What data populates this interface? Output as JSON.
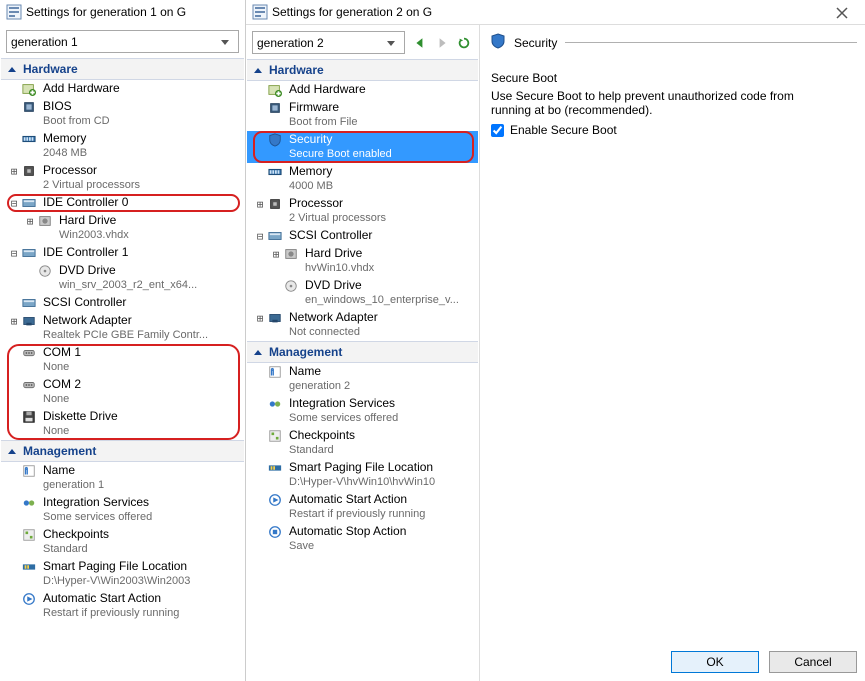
{
  "left": {
    "title": "Settings for generation 1 on G",
    "selector": "generation 1",
    "hardware_header": "Hardware",
    "management_header": "Management",
    "hardware": [
      {
        "label": "Add Hardware",
        "sub": "",
        "icon": "add-hardware",
        "exp": "",
        "indent": 0
      },
      {
        "label": "BIOS",
        "sub": "Boot from CD",
        "icon": "bios",
        "exp": "",
        "indent": 0
      },
      {
        "label": "Memory",
        "sub": "2048 MB",
        "icon": "memory",
        "exp": "",
        "indent": 0
      },
      {
        "label": "Processor",
        "sub": "2 Virtual processors",
        "icon": "cpu",
        "exp": "plus",
        "indent": 0
      },
      {
        "label": "IDE Controller 0",
        "sub": "",
        "icon": "ide",
        "exp": "minus",
        "indent": 0,
        "hl": "ide0"
      },
      {
        "label": "Hard Drive",
        "sub": "Win2003.vhdx",
        "icon": "hdd",
        "exp": "plus",
        "indent": 1
      },
      {
        "label": "IDE Controller 1",
        "sub": "",
        "icon": "ide",
        "exp": "minus",
        "indent": 0
      },
      {
        "label": "DVD Drive",
        "sub": "win_srv_2003_r2_ent_x64...",
        "icon": "dvd",
        "exp": "",
        "indent": 1
      },
      {
        "label": "SCSI Controller",
        "sub": "",
        "icon": "scsi",
        "exp": "",
        "indent": 0
      },
      {
        "label": "Network Adapter",
        "sub": "Realtek PCIe GBE Family Contr...",
        "icon": "nic",
        "exp": "plus",
        "indent": 0
      },
      {
        "label": "COM 1",
        "sub": "None",
        "icon": "com",
        "exp": "",
        "indent": 0,
        "grp": "extra"
      },
      {
        "label": "COM 2",
        "sub": "None",
        "icon": "com",
        "exp": "",
        "indent": 0,
        "grp": "extra"
      },
      {
        "label": "Diskette Drive",
        "sub": "None",
        "icon": "floppy",
        "exp": "",
        "indent": 0,
        "grp": "extra"
      }
    ],
    "management": [
      {
        "label": "Name",
        "sub": "generation 1",
        "icon": "name"
      },
      {
        "label": "Integration Services",
        "sub": "Some services offered",
        "icon": "integration"
      },
      {
        "label": "Checkpoints",
        "sub": "Standard",
        "icon": "checkpoint"
      },
      {
        "label": "Smart Paging File Location",
        "sub": "D:\\Hyper-V\\Win2003\\Win2003",
        "icon": "paging"
      },
      {
        "label": "Automatic Start Action",
        "sub": "Restart if previously running",
        "icon": "start"
      }
    ]
  },
  "right": {
    "title": "Settings for generation 2 on G",
    "selector": "generation 2",
    "hardware_header": "Hardware",
    "management_header": "Management",
    "hardware": [
      {
        "label": "Add Hardware",
        "sub": "",
        "icon": "add-hardware",
        "exp": "",
        "indent": 0
      },
      {
        "label": "Firmware",
        "sub": "Boot from File",
        "icon": "bios",
        "exp": "",
        "indent": 0
      },
      {
        "label": "Security",
        "sub": "Secure Boot enabled",
        "icon": "shield",
        "exp": "",
        "indent": 0,
        "selected": true,
        "hl": "sec"
      },
      {
        "label": "Memory",
        "sub": "4000 MB",
        "icon": "memory",
        "exp": "",
        "indent": 0
      },
      {
        "label": "Processor",
        "sub": "2 Virtual processors",
        "icon": "cpu",
        "exp": "plus",
        "indent": 0
      },
      {
        "label": "SCSI Controller",
        "sub": "",
        "icon": "scsi",
        "exp": "minus",
        "indent": 0
      },
      {
        "label": "Hard Drive",
        "sub": "hvWin10.vhdx",
        "icon": "hdd",
        "exp": "plus",
        "indent": 1
      },
      {
        "label": "DVD Drive",
        "sub": "en_windows_10_enterprise_v...",
        "icon": "dvd",
        "exp": "",
        "indent": 1
      },
      {
        "label": "Network Adapter",
        "sub": "Not connected",
        "icon": "nic",
        "exp": "plus",
        "indent": 0
      }
    ],
    "management": [
      {
        "label": "Name",
        "sub": "generation 2",
        "icon": "name"
      },
      {
        "label": "Integration Services",
        "sub": "Some services offered",
        "icon": "integration"
      },
      {
        "label": "Checkpoints",
        "sub": "Standard",
        "icon": "checkpoint"
      },
      {
        "label": "Smart Paging File Location",
        "sub": "D:\\Hyper-V\\hvWin10\\hvWin10",
        "icon": "paging"
      },
      {
        "label": "Automatic Start Action",
        "sub": "Restart if previously running",
        "icon": "start"
      },
      {
        "label": "Automatic Stop Action",
        "sub": "Save",
        "icon": "stop"
      }
    ],
    "detail": {
      "heading": "Security",
      "group": "Secure Boot",
      "desc": "Use Secure Boot to help prevent unauthorized code from running at bo (recommended).",
      "checkbox_label": "Enable Secure Boot",
      "checkbox_checked": true
    },
    "buttons": {
      "ok": "OK",
      "cancel": "Cancel"
    }
  }
}
